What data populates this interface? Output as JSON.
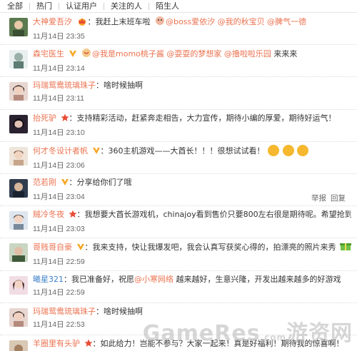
{
  "filters": [
    "全部",
    "热门",
    "认证用户",
    "关注的人",
    "陌生人"
  ],
  "actions": {
    "report": "举报",
    "reply": "回复"
  },
  "watermark": {
    "brand": "GameRes",
    "dot": ".com",
    "cn": "游资网"
  },
  "comments": [
    {
      "user": "大神爱吾汐",
      "color": "#eb7350",
      "text": "：我赶上末班车啦",
      "mentions": "@boss爱依汐 @我的秋宝贝 @脾气一德",
      "time": "11月14日 23:35",
      "avatar": "#5b7a4f"
    },
    {
      "user": "森宅医生",
      "color": "#eb7350",
      "text": "",
      "mentions": "@我是momo桃子酱 @耍耍的梦想家 @撸啦啦乐园",
      "tail": " 来来来",
      "time": "11月14日 23:14",
      "avatar": "#8aa39b"
    },
    {
      "user": "玛瑞鸳鸯琉璃珠子",
      "color": "#eb7350",
      "text": "：啥时候抽啊",
      "time": "11月14日 23:11",
      "avatar": "#b58b7e"
    },
    {
      "user": "抬死驴",
      "color": "#eb7350",
      "text": "：支持精彩活动，赶紧奔走相告，大力宣传，期待小编的厚爱，期待好运气！",
      "time": "11月14日 23:10",
      "avatar": "#6b4f5e"
    },
    {
      "user": "何才冬设计者帆",
      "color": "#eb7350",
      "text": "：360主机游戏——大酋长！！！很想试试看！",
      "time": "11月14日 23:06",
      "avatar": "#c7a58a"
    },
    {
      "user": "范若刚",
      "color": "#eb7350",
      "text": "：分享给你们了哦",
      "time": "11月14日 23:04",
      "avatar": "#2f3c4d"
    },
    {
      "user": "贼冷冬夜",
      "color": "#eb7350",
      "text": "：我想要大酋长游戏机，chinajoy看到售价只要800左右很是期待呢。希望抢到工程机",
      "time": "11月14日 23:03",
      "avatar": "#7a8a9c"
    },
    {
      "user": "哥贱哥自豪",
      "color": "#eb7350",
      "text": "：我来支持，快让我爆发吧，我会认真写获奖心得的，拍漂亮的照片来秀",
      "time": "11月14日 22:59",
      "avatar": "#3f5a3a"
    },
    {
      "user": "曦星321",
      "color": "#3d7fc8",
      "text": "：我已准备好，祝愿",
      "mention2": "@小寒网络",
      "tail": " 越来越好，生意兴隆，开发出越来越多的好游戏",
      "time": "11月14日 22:59",
      "avatar": "#c99aa8"
    },
    {
      "user": "玛瑞鸳鸯琉璃珠子",
      "color": "#eb7350",
      "text": "：啥时候抽啊",
      "time": "11月14日 22:53",
      "avatar": "#b58b7e"
    },
    {
      "user": "羊圈里有头驴",
      "color": "#eb7350",
      "text": "：如此给力！岂能不参与？大家一起来！真是好福利！期待我的惊喜啊！",
      "time": "",
      "avatar": "#8c6a4e"
    }
  ]
}
